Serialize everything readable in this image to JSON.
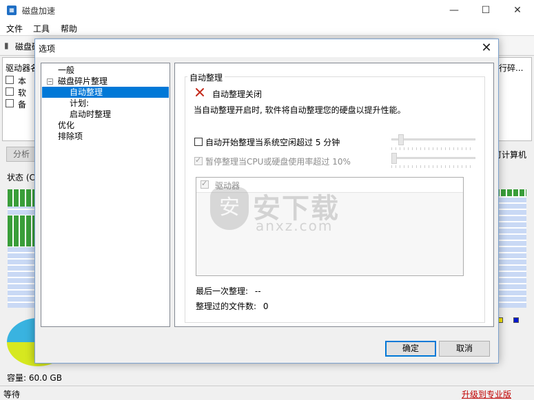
{
  "main_window": {
    "title": "磁盘加速",
    "controls": {
      "minimize": "—",
      "maximize": "☐",
      "close": "✕"
    },
    "menu": [
      "文件",
      "工具",
      "帮助"
    ],
    "toolbar_label": "磁盘碎",
    "drive_header": "驱动器名",
    "drive_header_right": "行碎...",
    "drives": [
      "本",
      "软",
      "备"
    ],
    "analyze_button": "分析",
    "right_button": "可计算机",
    "status_label": "状态 (C:",
    "capacity": "容量: 60.0 GB",
    "status_bar_left": "等待",
    "upgrade_link": "升级到专业版"
  },
  "dialog": {
    "title": "选项",
    "close_glyph": "✕",
    "tree": {
      "general": "一般",
      "defrag": "磁盘碎片整理",
      "auto_defrag": "自动整理",
      "schedule": "计划:",
      "boot_defrag": "启动时整理",
      "optimize": "优化",
      "exclusions": "排除项"
    },
    "panel": {
      "group_title": "自动整理",
      "status_text": "自动整理关闭",
      "description": "当自动整理开启时, 软件将自动整理您的硬盘以提升性能。",
      "idle_option": "自动开始整理当系统空闲超过 5 分钟",
      "cpu_option": "暂停整理当CPU或硬盘使用率超过 10%",
      "drives_column": "驱动器",
      "last_defrag_label": "最后一次整理:",
      "last_defrag_value": "--",
      "files_defragged_label": "整理过的文件数:",
      "files_defragged_value": "0"
    },
    "buttons": {
      "ok": "确定",
      "cancel": "取消"
    }
  },
  "watermark": {
    "text": "安下载",
    "sub": "anxz.com",
    "shield_glyph": "安"
  },
  "colors": {
    "selection": "#0078d7",
    "accent_icon_red": "#c42b1c",
    "link_red": "#c00000"
  }
}
